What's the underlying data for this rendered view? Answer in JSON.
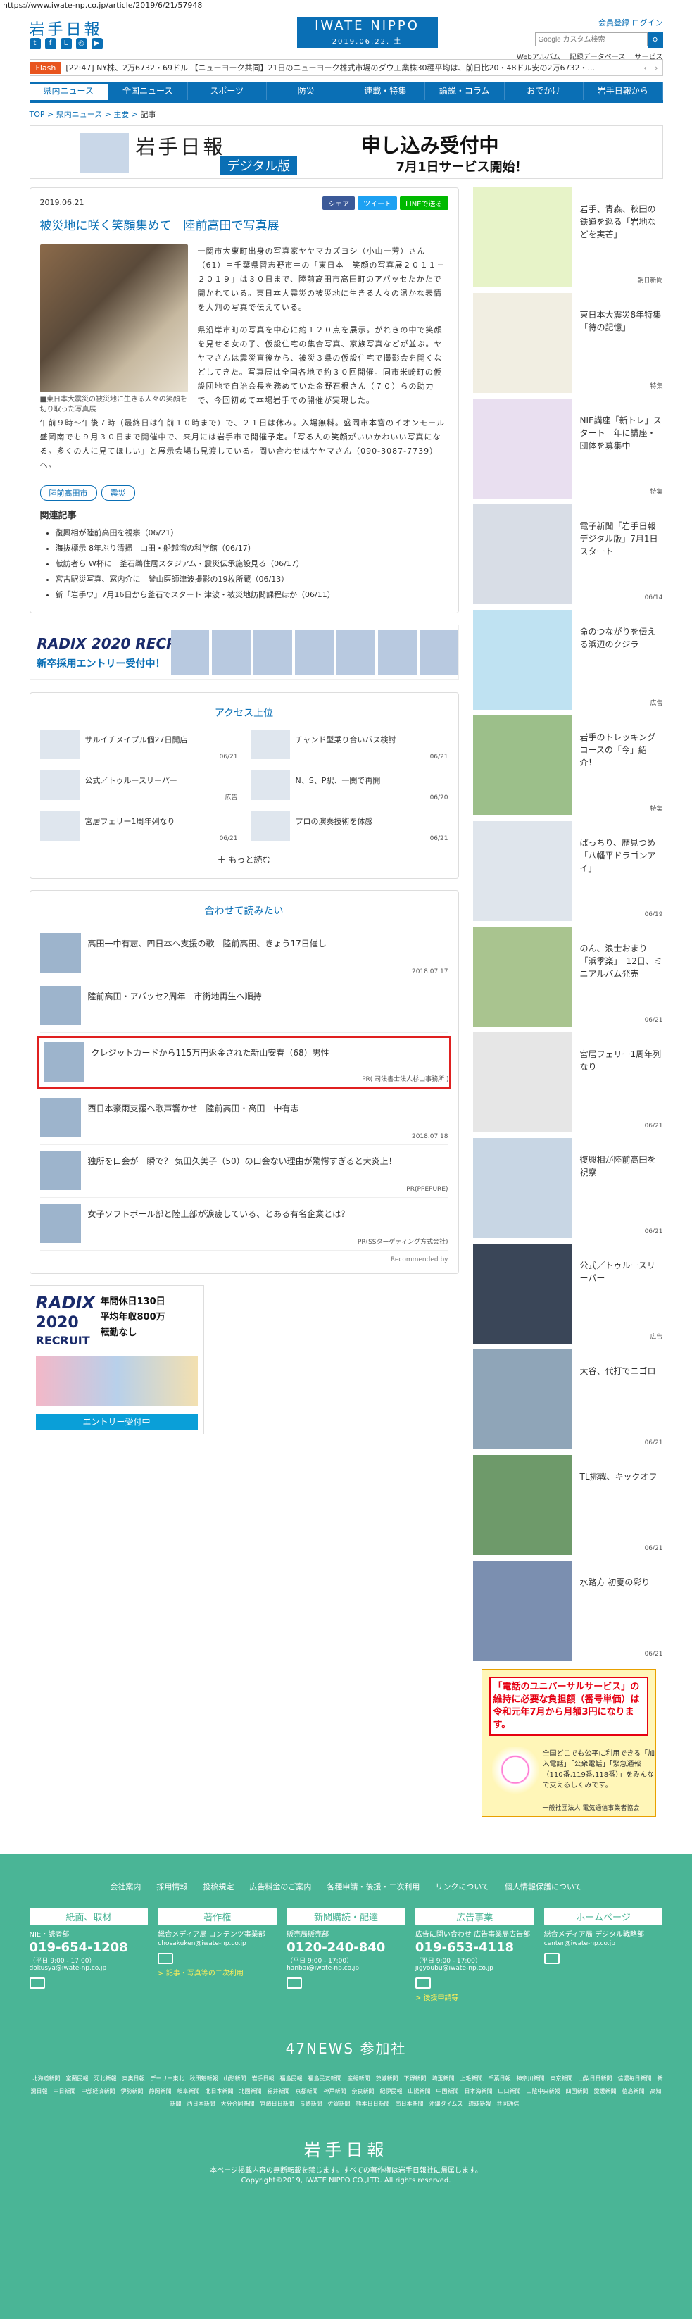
{
  "browser": {
    "url": "https://www.iwate-np.co.jp/article/2019/6/21/57948"
  },
  "header": {
    "logo": "岩手日報",
    "center_title": "IWATE NIPPO",
    "center_date": "2019.06.22. 土",
    "account": "会員登録 ログイン",
    "search_placeholder": "Google カスタム検索",
    "links": [
      "Webアルバム",
      "記録データベース",
      "サービス"
    ]
  },
  "flash": {
    "label": "Flash",
    "text": "[22:47] NY株、2万6732・69ドル 【ニューヨーク共同】21日のニューヨーク株式市場のダウ工業株30種平均は、前日比20・48ドル安の2万6732・..."
  },
  "nav": {
    "items": [
      "県内ニュース",
      "全国ニュース",
      "スポーツ",
      "防災",
      "連載・特集",
      "論説・コラム",
      "おでかけ",
      "岩手日報から"
    ]
  },
  "breadcrumb": {
    "top": "TOP",
    "sep": ">",
    "level1": "県内ニュース",
    "level2": "主要",
    "current": "記事"
  },
  "banner": {
    "logo": "岩手日報",
    "digital": "デジタル版",
    "headline": "申し込み受付中",
    "sub": "7月1日サービス開始！"
  },
  "article": {
    "date": "2019.06.21",
    "share_fb": "シェア",
    "share_tw": "ツイート",
    "share_line": "LINEで送る",
    "title": "被災地に咲く笑顔集めて　陸前高田で写真展",
    "caption": "■東日本大震災の被災地に生きる人々の笑顔を切り取った写真展",
    "p1": "一関市大東町出身の写真家ヤヤマカズヨシ（小山一芳）さん（61）＝千葉県習志野市＝の「東日本　笑顔の写真展２０１１－２０１９」は３０日まで、陸前高田市高田町のアバッセたかたで開かれている。東日本大震災の被災地に生きる人々の温かな表情を大判の写真で伝えている。",
    "p2": "県沿岸市町の写真を中心に約１２０点を展示。がれきの中で笑顔を見せる女の子、仮設住宅の集合写真、家族写真などが並ぶ。ヤヤマさんは震災直後から、被災３県の仮設住宅で撮影会を開くなどしてきた。写真展は全国各地で約３０回開催。同市米崎町の仮設団地で自治会長を務めていた金野石根さん（７０）らの助力で、今回初めて本場岩手での開催が実現した。",
    "p3": "午前９時～午後７時（最終日は午前１０時まで）で、２１日は休み。入場無料。盛岡市本宮のイオンモール盛岡南でも９月３０日まで開催中で、来月には岩手市で開催予定。「写る人の笑顔がいいかわいい写真になる。多くの人に見てほしい」と展示会場も見渡している。問い合わせはヤヤマさん（090-3087-7739）へ。",
    "tags": [
      "陸前高田市",
      "震災"
    ],
    "related_title": "関連記事",
    "related": [
      "復興相が陸前高田を視察（06/21）",
      "海抜標示 8年ぶり清掃　山田・船越湾の科学館（06/17）",
      "献訪者ら W杯に　釜石鵜住居スタジアム・震災伝承施設見る（06/17）",
      "宮古駅災写真、窓内介に　釜山医師津波撮影の19枚所蔵（06/13）",
      "新「岩手ワ」7月16日から釜石でスタート 津波・被災地訪問課程ほか（06/11）"
    ]
  },
  "ad_wide": {
    "brand": "RADIX 2020 RECRUIT",
    "line": "新卒採用エントリー受付中！"
  },
  "access": {
    "title": "アクセス上位",
    "items": [
      {
        "text": "サルイチメイプル個27日開店",
        "date": "06/21"
      },
      {
        "text": "チャンド型乗り合いバス検討",
        "date": "06/21"
      },
      {
        "text": "公式／トゥルースリーパー",
        "date": "広告"
      },
      {
        "text": "N、S、P駅、一関で再開",
        "date": "06/20"
      },
      {
        "text": "宮居フェリー1周年列なり",
        "date": "06/21"
      },
      {
        "text": "プロの演奏技術を体感",
        "date": "06/21"
      }
    ],
    "more": "もっと読む"
  },
  "recommend": {
    "title": "合わせて読みたい",
    "items": [
      {
        "text": "高田一中有志、四日本へ支援の歌　陸前高田、きょう17日催し",
        "meta": "2018.07.17"
      },
      {
        "text": "陸前高田・アバッセ2周年　市街地再生へ順持",
        "meta": ""
      },
      {
        "text": "クレジットカードから115万円返金された新山安春（68）男性",
        "meta": "PR( 司法書士法人杉山事務所 )"
      },
      {
        "text": "西日本豪雨支援へ歌声響かせ　陸前高田・高田一中有志",
        "meta": "2018.07.18"
      },
      {
        "text": "独所を口会が一瞬で？ 気田久美子（50）の口会ない理由が驚愕すぎると大炎上！",
        "meta": "PR(PPEPURE)"
      },
      {
        "text": "女子ソフトボール部と陸上部が涙疲している、とある有名企業とは？",
        "meta": "PR(SSターゲティング方式会社)"
      }
    ],
    "by": "Recommended by"
  },
  "ad_square": {
    "brand": "RADIX",
    "year": "2020",
    "recruit": "RECRUIT",
    "facts": [
      "年間休日130日",
      "平均年収800万",
      "転勤なし"
    ],
    "button": "エントリー受付中"
  },
  "sidebar": {
    "items": [
      {
        "text": "岩手、青森、秋田の鉄道を巡る「岩地などを実芒」",
        "date": "朝日新聞"
      },
      {
        "text": "東日本大震災8年特集「待の記憶」",
        "date": "特集"
      },
      {
        "text": "NIE講座「新トレ」スタート　年に講座・団体を募集中",
        "date": "特集"
      },
      {
        "text": "電子新聞「岩手日報デジタル版」7月1日スタート",
        "date": "06/14"
      },
      {
        "text": "命のつながりを伝える浜辺のクジラ",
        "date": "広告"
      },
      {
        "text": "岩手のトレッキングコースの「今」紹介！",
        "date": "特集"
      },
      {
        "text": "ぱっちり、歴見つめ　「八幡平ドラゴンアイ」",
        "date": "06/19"
      },
      {
        "text": "のん、浪士おまり「浜季楽」　12日、ミニアルバム発売",
        "date": "06/21"
      },
      {
        "text": "宮居フェリー1周年列なり",
        "date": "06/21"
      },
      {
        "text": "復興相が陸前高田を視察",
        "date": "06/21"
      },
      {
        "text": "公式／トゥルースリーパー",
        "date": "広告"
      },
      {
        "text": "大谷、代打でニゴロ",
        "date": "06/21"
      },
      {
        "text": "TL挑戦、キックオフ",
        "date": "06/21"
      },
      {
        "text": "水路方 初夏の彩り",
        "date": "06/21"
      }
    ],
    "ad": {
      "t1": "「電話のユニバーサルサービス」の維持に必要な負担額（番号単価）は令和元年7月から月額3円になります。",
      "t2": "全国どこでも公平に利用できる「加入電話」「公衆電話」「緊急通報（110番,119番,118番）」をみんなで支えるしくみです。",
      "t3": "一般社団法人 電気通信事業者協会"
    }
  },
  "footer": {
    "links": [
      "会社案内",
      "採用情報",
      "投稿規定",
      "広告料金のご案内",
      "各種申請・後援・二次利用",
      "リンクについて",
      "個人情報保護について"
    ],
    "boxes": [
      {
        "head": "紙面、取材",
        "label": "NIE・読者部",
        "tel": "019-654-1208",
        "hours": "（平日 9:00 - 17:00）",
        "mail": "dokusya@iwate-np.co.jp",
        "extra": ""
      },
      {
        "head": "著作権",
        "label": "総合メディア局 コンテンツ事業部",
        "tel": "",
        "hours": "",
        "mail": "chosakuken@iwate-np.co.jp",
        "extra": "> 記事・写真等の二次利用"
      },
      {
        "head": "新聞購読・配達",
        "label": "販売局販売部",
        "tel": "0120-240-840",
        "hours": "（平日 9:00 - 17:00）",
        "mail": "hanbai@iwate-np.co.jp",
        "extra": ""
      },
      {
        "head": "広告事業",
        "label": "広告に関い合わせ 広告事業局広告部",
        "tel": "019-653-4118",
        "hours": "（平日 9:00 - 17:00）",
        "mail": "jigyoubu@iwate-np.co.jp",
        "extra": "> 後援申請等"
      },
      {
        "head": "ホームページ",
        "label": "総合メディア局 デジタル戦略部",
        "tel": "",
        "hours": "",
        "mail": "center@iwate-np.co.jp",
        "extra": ""
      }
    ],
    "news47": "47NEWS 参加社",
    "papers": [
      "北海道新聞",
      "室蘭民報",
      "河北新報",
      "東奥日報",
      "デーリー東北",
      "秋田魁新報",
      "山形新聞",
      "岩手日報",
      "福島民報",
      "福島民友新聞",
      "産経新聞",
      "茨城新聞",
      "下野新聞",
      "埼玉新聞",
      "上毛新聞",
      "千葉日報",
      "神奈川新聞",
      "東京新聞",
      "山梨日日新聞",
      "信濃毎日新聞",
      "新潟日報",
      "中日新聞",
      "中部経済新聞",
      "伊勢新聞",
      "静岡新聞",
      "岐阜新聞",
      "北日本新聞",
      "北國新聞",
      "福井新聞",
      "京都新聞",
      "神戸新聞",
      "奈良新聞",
      "紀伊民報",
      "山陽新聞",
      "中国新聞",
      "日本海新聞",
      "山口新聞",
      "山陰中央新報",
      "四国新聞",
      "愛媛新聞",
      "徳島新聞",
      "高知新聞",
      "西日本新聞",
      "大分合同新聞",
      "宮崎日日新聞",
      "長崎新聞",
      "佐賀新聞",
      "熊本日日新聞",
      "南日本新聞",
      "沖縄タイムス",
      "琉球新報",
      "共同通信"
    ],
    "logo": "岩手日報",
    "copy1": "本ページ掲載内容の無断転載を禁じます。すべての著作権は岩手日報社に帰属します。",
    "copy2": "Copyright©2019, IWATE NIPPO CO.,LTD. All rights reserved."
  }
}
